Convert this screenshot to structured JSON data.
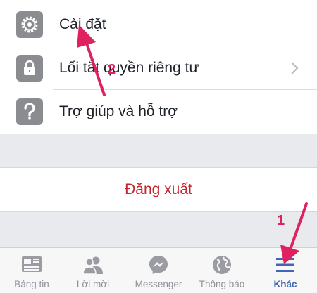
{
  "menu": {
    "items": [
      {
        "label": "Cài đặt",
        "icon": "gear-icon"
      },
      {
        "label": "Lối tắt quyền riêng tư",
        "icon": "lock-icon"
      },
      {
        "label": "Trợ giúp và hỗ trợ",
        "icon": "question-icon"
      }
    ],
    "logout_label": "Đăng xuất"
  },
  "tabbar": {
    "tabs": [
      {
        "label": "Bảng tin",
        "icon": "news-feed-icon"
      },
      {
        "label": "Lời mời",
        "icon": "friends-icon"
      },
      {
        "label": "Messenger",
        "icon": "messenger-icon"
      },
      {
        "label": "Thông báo",
        "icon": "globe-icon"
      },
      {
        "label": "Khác",
        "icon": "menu-icon",
        "active": true
      }
    ]
  },
  "annotations": {
    "step1": "1",
    "step2": "2",
    "arrow_color": "#e0215f"
  },
  "colors": {
    "accent": "#4267b2",
    "logout": "#c4262e",
    "icon_bg": "#8a8c90"
  }
}
